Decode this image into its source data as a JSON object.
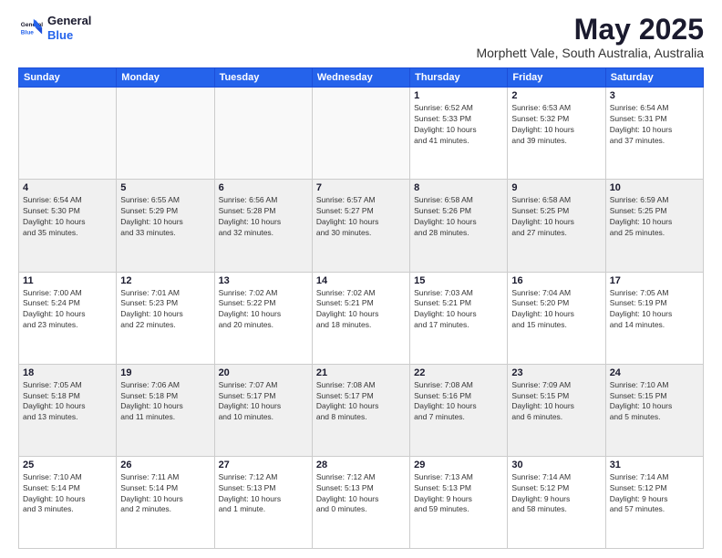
{
  "header": {
    "logo_line1": "General",
    "logo_line2": "Blue",
    "title": "May 2025",
    "subtitle": "Morphett Vale, South Australia, Australia"
  },
  "calendar": {
    "days_of_week": [
      "Sunday",
      "Monday",
      "Tuesday",
      "Wednesday",
      "Thursday",
      "Friday",
      "Saturday"
    ],
    "weeks": [
      [
        {
          "day": "",
          "info": ""
        },
        {
          "day": "",
          "info": ""
        },
        {
          "day": "",
          "info": ""
        },
        {
          "day": "",
          "info": ""
        },
        {
          "day": "1",
          "info": "Sunrise: 6:52 AM\nSunset: 5:33 PM\nDaylight: 10 hours\nand 41 minutes."
        },
        {
          "day": "2",
          "info": "Sunrise: 6:53 AM\nSunset: 5:32 PM\nDaylight: 10 hours\nand 39 minutes."
        },
        {
          "day": "3",
          "info": "Sunrise: 6:54 AM\nSunset: 5:31 PM\nDaylight: 10 hours\nand 37 minutes."
        }
      ],
      [
        {
          "day": "4",
          "info": "Sunrise: 6:54 AM\nSunset: 5:30 PM\nDaylight: 10 hours\nand 35 minutes."
        },
        {
          "day": "5",
          "info": "Sunrise: 6:55 AM\nSunset: 5:29 PM\nDaylight: 10 hours\nand 33 minutes."
        },
        {
          "day": "6",
          "info": "Sunrise: 6:56 AM\nSunset: 5:28 PM\nDaylight: 10 hours\nand 32 minutes."
        },
        {
          "day": "7",
          "info": "Sunrise: 6:57 AM\nSunset: 5:27 PM\nDaylight: 10 hours\nand 30 minutes."
        },
        {
          "day": "8",
          "info": "Sunrise: 6:58 AM\nSunset: 5:26 PM\nDaylight: 10 hours\nand 28 minutes."
        },
        {
          "day": "9",
          "info": "Sunrise: 6:58 AM\nSunset: 5:25 PM\nDaylight: 10 hours\nand 27 minutes."
        },
        {
          "day": "10",
          "info": "Sunrise: 6:59 AM\nSunset: 5:25 PM\nDaylight: 10 hours\nand 25 minutes."
        }
      ],
      [
        {
          "day": "11",
          "info": "Sunrise: 7:00 AM\nSunset: 5:24 PM\nDaylight: 10 hours\nand 23 minutes."
        },
        {
          "day": "12",
          "info": "Sunrise: 7:01 AM\nSunset: 5:23 PM\nDaylight: 10 hours\nand 22 minutes."
        },
        {
          "day": "13",
          "info": "Sunrise: 7:02 AM\nSunset: 5:22 PM\nDaylight: 10 hours\nand 20 minutes."
        },
        {
          "day": "14",
          "info": "Sunrise: 7:02 AM\nSunset: 5:21 PM\nDaylight: 10 hours\nand 18 minutes."
        },
        {
          "day": "15",
          "info": "Sunrise: 7:03 AM\nSunset: 5:21 PM\nDaylight: 10 hours\nand 17 minutes."
        },
        {
          "day": "16",
          "info": "Sunrise: 7:04 AM\nSunset: 5:20 PM\nDaylight: 10 hours\nand 15 minutes."
        },
        {
          "day": "17",
          "info": "Sunrise: 7:05 AM\nSunset: 5:19 PM\nDaylight: 10 hours\nand 14 minutes."
        }
      ],
      [
        {
          "day": "18",
          "info": "Sunrise: 7:05 AM\nSunset: 5:18 PM\nDaylight: 10 hours\nand 13 minutes."
        },
        {
          "day": "19",
          "info": "Sunrise: 7:06 AM\nSunset: 5:18 PM\nDaylight: 10 hours\nand 11 minutes."
        },
        {
          "day": "20",
          "info": "Sunrise: 7:07 AM\nSunset: 5:17 PM\nDaylight: 10 hours\nand 10 minutes."
        },
        {
          "day": "21",
          "info": "Sunrise: 7:08 AM\nSunset: 5:17 PM\nDaylight: 10 hours\nand 8 minutes."
        },
        {
          "day": "22",
          "info": "Sunrise: 7:08 AM\nSunset: 5:16 PM\nDaylight: 10 hours\nand 7 minutes."
        },
        {
          "day": "23",
          "info": "Sunrise: 7:09 AM\nSunset: 5:15 PM\nDaylight: 10 hours\nand 6 minutes."
        },
        {
          "day": "24",
          "info": "Sunrise: 7:10 AM\nSunset: 5:15 PM\nDaylight: 10 hours\nand 5 minutes."
        }
      ],
      [
        {
          "day": "25",
          "info": "Sunrise: 7:10 AM\nSunset: 5:14 PM\nDaylight: 10 hours\nand 3 minutes."
        },
        {
          "day": "26",
          "info": "Sunrise: 7:11 AM\nSunset: 5:14 PM\nDaylight: 10 hours\nand 2 minutes."
        },
        {
          "day": "27",
          "info": "Sunrise: 7:12 AM\nSunset: 5:13 PM\nDaylight: 10 hours\nand 1 minute."
        },
        {
          "day": "28",
          "info": "Sunrise: 7:12 AM\nSunset: 5:13 PM\nDaylight: 10 hours\nand 0 minutes."
        },
        {
          "day": "29",
          "info": "Sunrise: 7:13 AM\nSunset: 5:13 PM\nDaylight: 9 hours\nand 59 minutes."
        },
        {
          "day": "30",
          "info": "Sunrise: 7:14 AM\nSunset: 5:12 PM\nDaylight: 9 hours\nand 58 minutes."
        },
        {
          "day": "31",
          "info": "Sunrise: 7:14 AM\nSunset: 5:12 PM\nDaylight: 9 hours\nand 57 minutes."
        }
      ]
    ]
  }
}
